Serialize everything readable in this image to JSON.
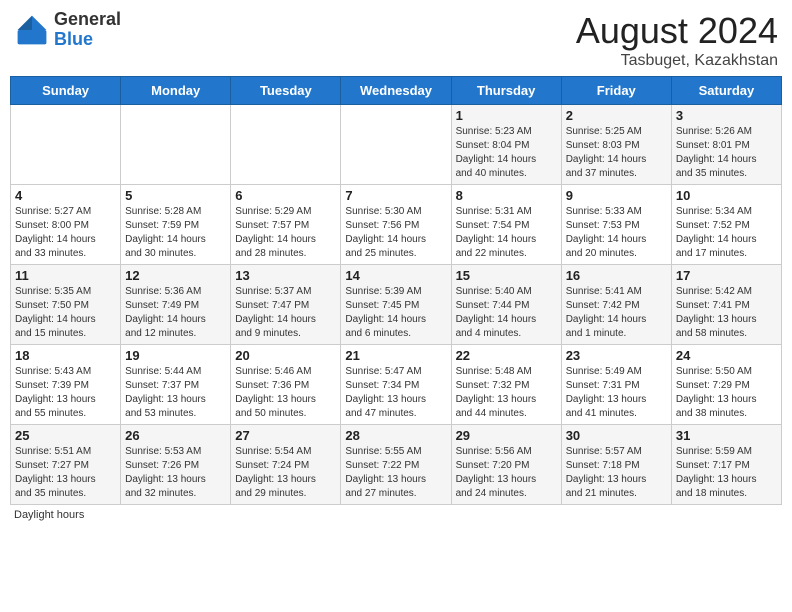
{
  "header": {
    "logo_general": "General",
    "logo_blue": "Blue",
    "title": "August 2024",
    "location": "Tasbuget, Kazakhstan"
  },
  "calendar": {
    "days_of_week": [
      "Sunday",
      "Monday",
      "Tuesday",
      "Wednesday",
      "Thursday",
      "Friday",
      "Saturday"
    ],
    "weeks": [
      [
        {
          "day": "",
          "info": ""
        },
        {
          "day": "",
          "info": ""
        },
        {
          "day": "",
          "info": ""
        },
        {
          "day": "",
          "info": ""
        },
        {
          "day": "1",
          "info": "Sunrise: 5:23 AM\nSunset: 8:04 PM\nDaylight: 14 hours\nand 40 minutes."
        },
        {
          "day": "2",
          "info": "Sunrise: 5:25 AM\nSunset: 8:03 PM\nDaylight: 14 hours\nand 37 minutes."
        },
        {
          "day": "3",
          "info": "Sunrise: 5:26 AM\nSunset: 8:01 PM\nDaylight: 14 hours\nand 35 minutes."
        }
      ],
      [
        {
          "day": "4",
          "info": "Sunrise: 5:27 AM\nSunset: 8:00 PM\nDaylight: 14 hours\nand 33 minutes."
        },
        {
          "day": "5",
          "info": "Sunrise: 5:28 AM\nSunset: 7:59 PM\nDaylight: 14 hours\nand 30 minutes."
        },
        {
          "day": "6",
          "info": "Sunrise: 5:29 AM\nSunset: 7:57 PM\nDaylight: 14 hours\nand 28 minutes."
        },
        {
          "day": "7",
          "info": "Sunrise: 5:30 AM\nSunset: 7:56 PM\nDaylight: 14 hours\nand 25 minutes."
        },
        {
          "day": "8",
          "info": "Sunrise: 5:31 AM\nSunset: 7:54 PM\nDaylight: 14 hours\nand 22 minutes."
        },
        {
          "day": "9",
          "info": "Sunrise: 5:33 AM\nSunset: 7:53 PM\nDaylight: 14 hours\nand 20 minutes."
        },
        {
          "day": "10",
          "info": "Sunrise: 5:34 AM\nSunset: 7:52 PM\nDaylight: 14 hours\nand 17 minutes."
        }
      ],
      [
        {
          "day": "11",
          "info": "Sunrise: 5:35 AM\nSunset: 7:50 PM\nDaylight: 14 hours\nand 15 minutes."
        },
        {
          "day": "12",
          "info": "Sunrise: 5:36 AM\nSunset: 7:49 PM\nDaylight: 14 hours\nand 12 minutes."
        },
        {
          "day": "13",
          "info": "Sunrise: 5:37 AM\nSunset: 7:47 PM\nDaylight: 14 hours\nand 9 minutes."
        },
        {
          "day": "14",
          "info": "Sunrise: 5:39 AM\nSunset: 7:45 PM\nDaylight: 14 hours\nand 6 minutes."
        },
        {
          "day": "15",
          "info": "Sunrise: 5:40 AM\nSunset: 7:44 PM\nDaylight: 14 hours\nand 4 minutes."
        },
        {
          "day": "16",
          "info": "Sunrise: 5:41 AM\nSunset: 7:42 PM\nDaylight: 14 hours\nand 1 minute."
        },
        {
          "day": "17",
          "info": "Sunrise: 5:42 AM\nSunset: 7:41 PM\nDaylight: 13 hours\nand 58 minutes."
        }
      ],
      [
        {
          "day": "18",
          "info": "Sunrise: 5:43 AM\nSunset: 7:39 PM\nDaylight: 13 hours\nand 55 minutes."
        },
        {
          "day": "19",
          "info": "Sunrise: 5:44 AM\nSunset: 7:37 PM\nDaylight: 13 hours\nand 53 minutes."
        },
        {
          "day": "20",
          "info": "Sunrise: 5:46 AM\nSunset: 7:36 PM\nDaylight: 13 hours\nand 50 minutes."
        },
        {
          "day": "21",
          "info": "Sunrise: 5:47 AM\nSunset: 7:34 PM\nDaylight: 13 hours\nand 47 minutes."
        },
        {
          "day": "22",
          "info": "Sunrise: 5:48 AM\nSunset: 7:32 PM\nDaylight: 13 hours\nand 44 minutes."
        },
        {
          "day": "23",
          "info": "Sunrise: 5:49 AM\nSunset: 7:31 PM\nDaylight: 13 hours\nand 41 minutes."
        },
        {
          "day": "24",
          "info": "Sunrise: 5:50 AM\nSunset: 7:29 PM\nDaylight: 13 hours\nand 38 minutes."
        }
      ],
      [
        {
          "day": "25",
          "info": "Sunrise: 5:51 AM\nSunset: 7:27 PM\nDaylight: 13 hours\nand 35 minutes."
        },
        {
          "day": "26",
          "info": "Sunrise: 5:53 AM\nSunset: 7:26 PM\nDaylight: 13 hours\nand 32 minutes."
        },
        {
          "day": "27",
          "info": "Sunrise: 5:54 AM\nSunset: 7:24 PM\nDaylight: 13 hours\nand 29 minutes."
        },
        {
          "day": "28",
          "info": "Sunrise: 5:55 AM\nSunset: 7:22 PM\nDaylight: 13 hours\nand 27 minutes."
        },
        {
          "day": "29",
          "info": "Sunrise: 5:56 AM\nSunset: 7:20 PM\nDaylight: 13 hours\nand 24 minutes."
        },
        {
          "day": "30",
          "info": "Sunrise: 5:57 AM\nSunset: 7:18 PM\nDaylight: 13 hours\nand 21 minutes."
        },
        {
          "day": "31",
          "info": "Sunrise: 5:59 AM\nSunset: 7:17 PM\nDaylight: 13 hours\nand 18 minutes."
        }
      ]
    ]
  },
  "footer": {
    "label": "Daylight hours"
  }
}
